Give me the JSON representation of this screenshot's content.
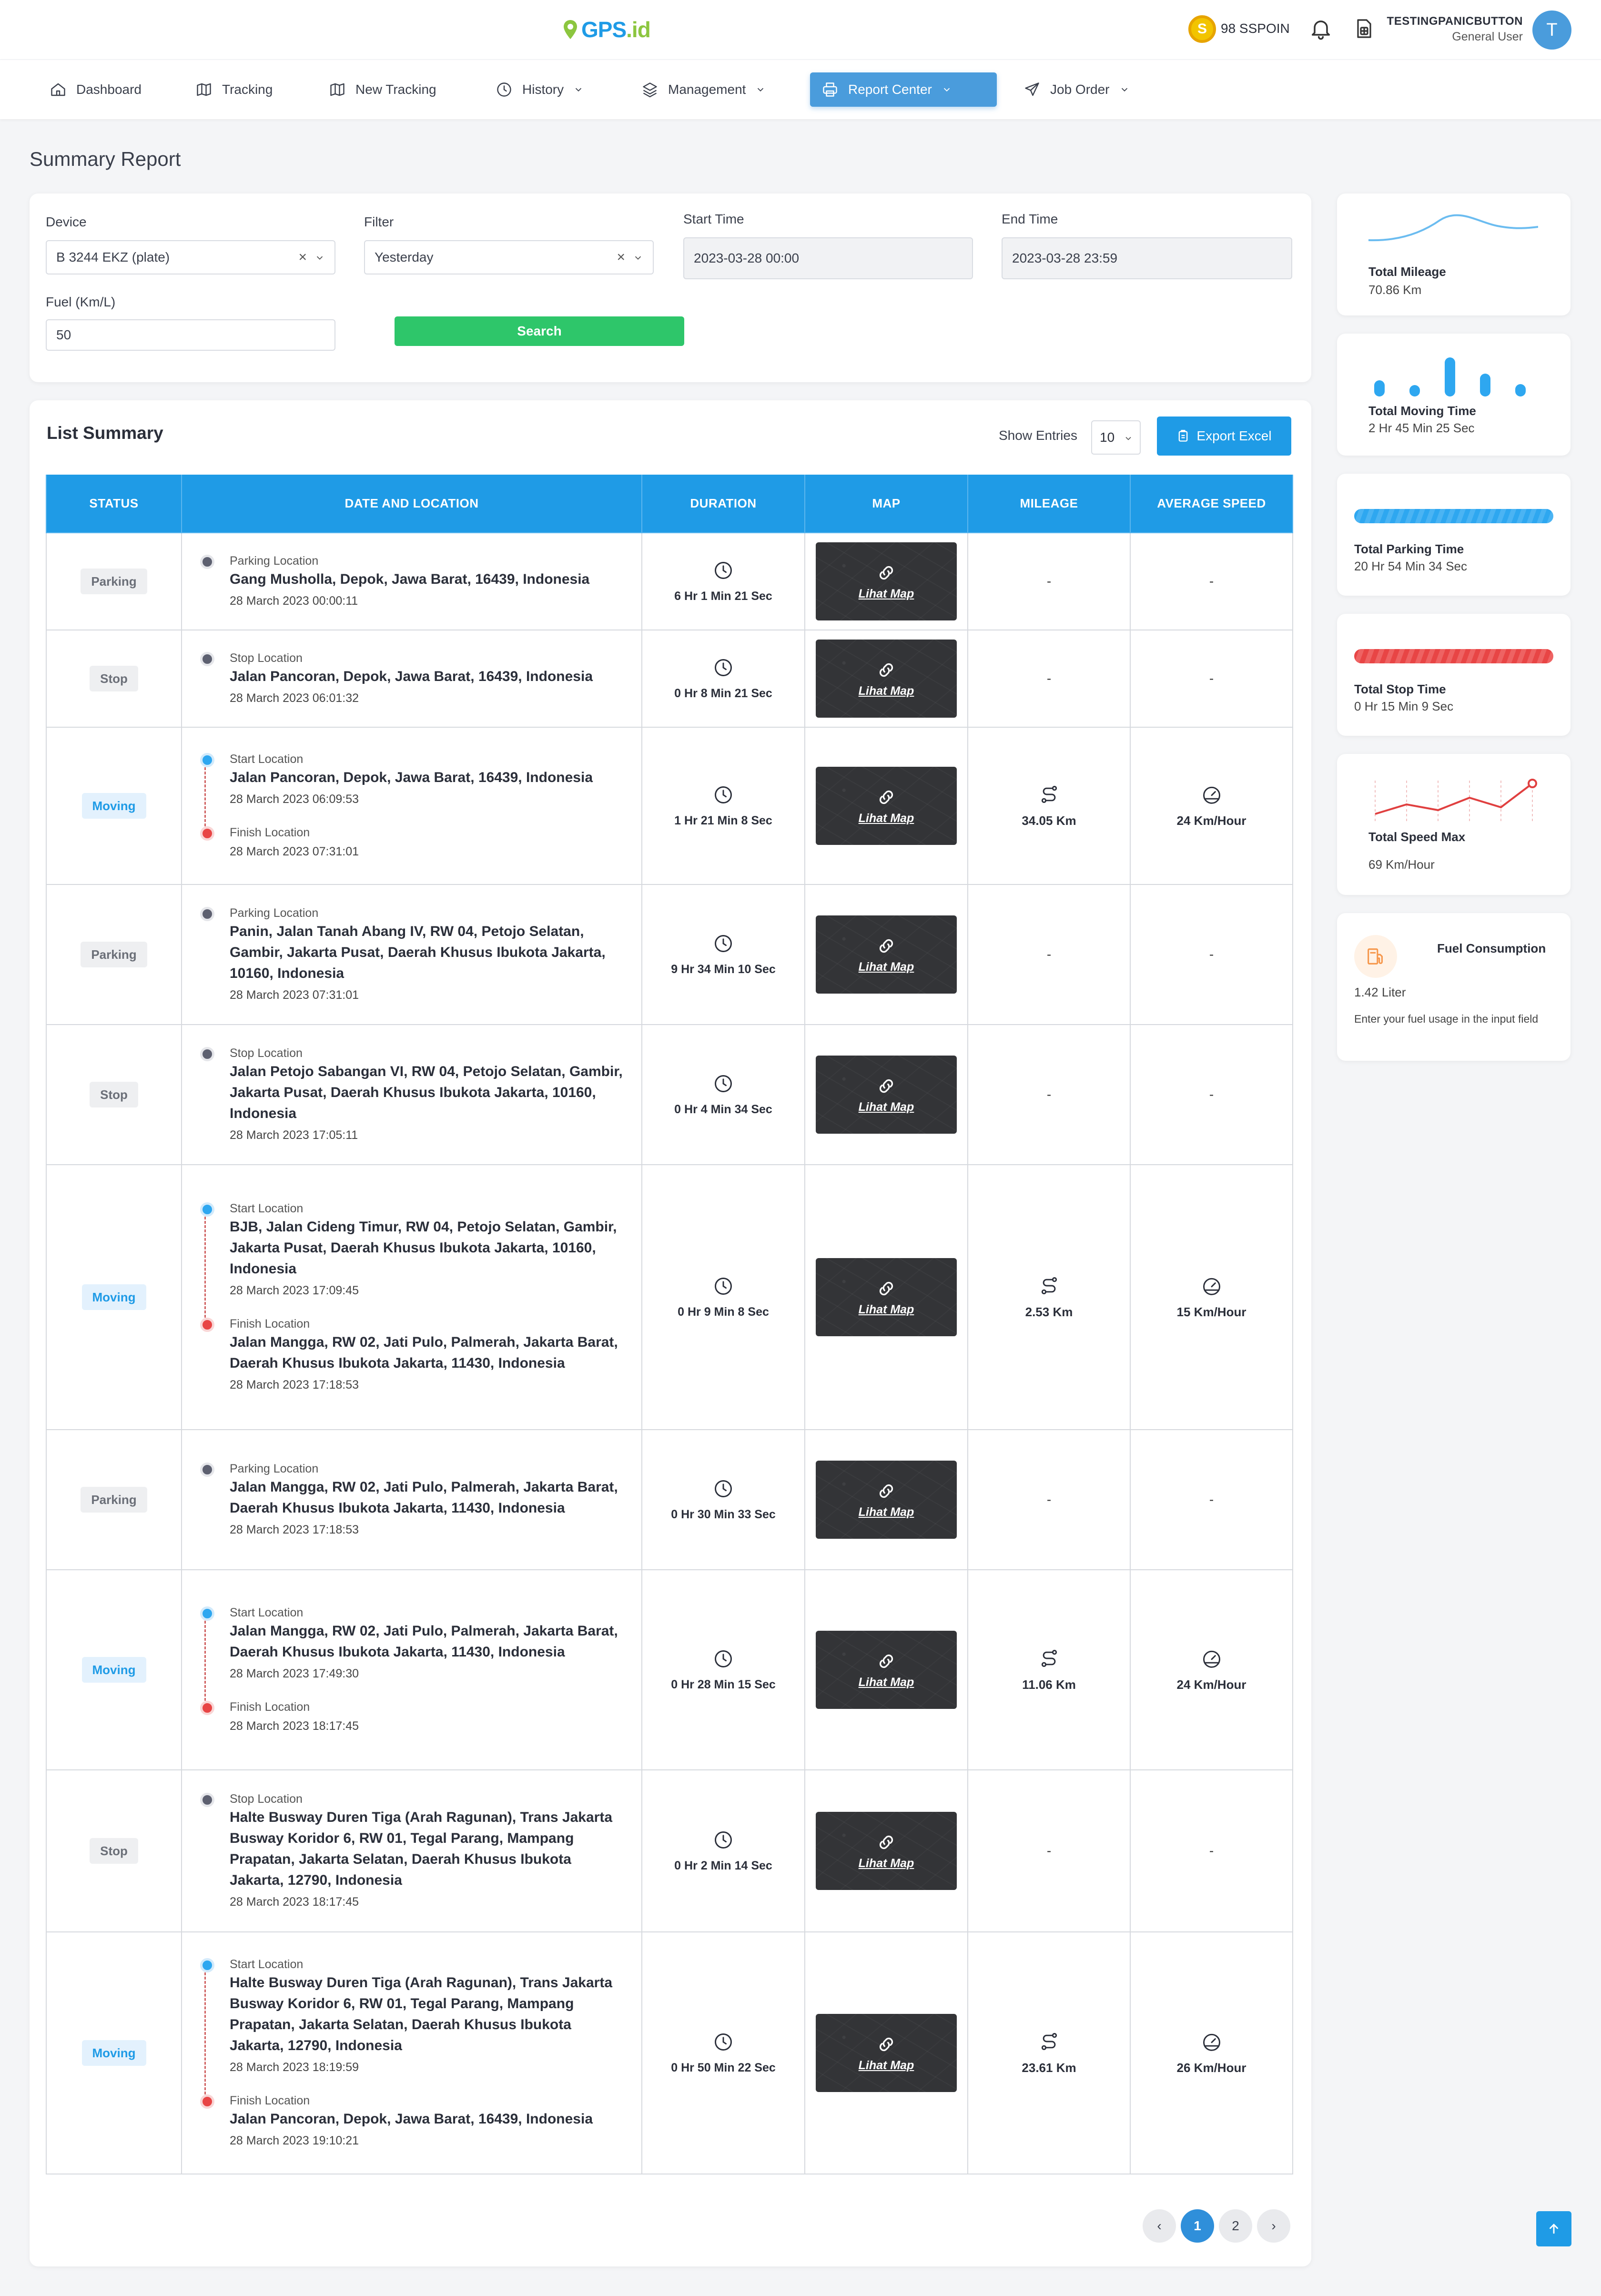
{
  "brand": {
    "logo_text_a": "GPS",
    "logo_text_b": ".id"
  },
  "header": {
    "points_label": "98 SSPOIN",
    "coin_symbol": "S",
    "user_name": "TESTINGPANICBUTTON",
    "user_role": "General User",
    "avatar_initial": "T"
  },
  "nav": {
    "dashboard": "Dashboard",
    "tracking": "Tracking",
    "new_tracking": "New Tracking",
    "history": "History",
    "management": "Management",
    "report_center": "Report Center",
    "job_order": "Job Order"
  },
  "page": {
    "title": "Summary Report"
  },
  "filters": {
    "device_label": "Device",
    "device_value": "B 3244 EKZ (plate)",
    "filter_label": "Filter",
    "filter_value": "Yesterday",
    "start_label": "Start Time",
    "start_value": "2023-03-28 00:00",
    "end_label": "End Time",
    "end_value": "2023-03-28 23:59",
    "fuel_label": "Fuel (Km/L)",
    "fuel_value": "50",
    "search_label": "Search",
    "clear_symbol": "×"
  },
  "list": {
    "title": "List Summary",
    "show_entries_label": "Show Entries",
    "entries_value": "10",
    "export_label": "Export Excel",
    "columns": [
      "STATUS",
      "DATE AND LOCATION",
      "DURATION",
      "MAP",
      "MILEAGE",
      "AVERAGE SPEED"
    ],
    "map_link": "Lihat Map",
    "dash": "-",
    "rows": [
      {
        "status": "Parking",
        "kind": "single",
        "label": "Parking Location",
        "address": "Gang Musholla, Depok, Jawa Barat, 16439, Indonesia",
        "time": "28 March 2023 00:00:11",
        "duration": "6 Hr 1 Min 21 Sec"
      },
      {
        "status": "Stop",
        "kind": "single",
        "label": "Stop Location",
        "address": "Jalan Pancoran, Depok, Jawa Barat, 16439, Indonesia",
        "time": "28 March 2023 06:01:32",
        "duration": "0 Hr 8 Min 21 Sec"
      },
      {
        "status": "Moving",
        "kind": "move",
        "start_label": "Start Location",
        "start_address": "Jalan Pancoran, Depok, Jawa Barat, 16439, Indonesia",
        "start_time": "28 March 2023 06:09:53",
        "finish_label": "Finish Location",
        "finish_address": "",
        "finish_time": "28 March 2023 07:31:01",
        "duration": "1 Hr 21 Min 8 Sec",
        "mileage": "34.05 Km",
        "speed": "24 Km/Hour"
      },
      {
        "status": "Parking",
        "kind": "single",
        "label": "Parking Location",
        "address": "Panin, Jalan Tanah Abang IV, RW 04, Petojo Selatan, Gambir, Jakarta Pusat, Daerah Khusus Ibukota Jakarta, 10160, Indonesia",
        "time": "28 March 2023 07:31:01",
        "duration": "9 Hr 34 Min 10 Sec"
      },
      {
        "status": "Stop",
        "kind": "single",
        "label": "Stop Location",
        "address": "Jalan Petojo Sabangan VI, RW 04, Petojo Selatan, Gambir, Jakarta Pusat, Daerah Khusus Ibukota Jakarta, 10160, Indonesia",
        "time": "28 March 2023 17:05:11",
        "duration": "0 Hr 4 Min 34 Sec"
      },
      {
        "status": "Moving",
        "kind": "move",
        "start_label": "Start Location",
        "start_address": "BJB, Jalan Cideng Timur, RW 04, Petojo Selatan, Gambir, Jakarta Pusat, Daerah Khusus Ibukota Jakarta, 10160, Indonesia",
        "start_time": "28 March 2023 17:09:45",
        "finish_label": "Finish Location",
        "finish_address": "Jalan Mangga, RW 02, Jati Pulo, Palmerah, Jakarta Barat, Daerah Khusus Ibukota Jakarta, 11430, Indonesia",
        "finish_time": "28 March 2023 17:18:53",
        "duration": "0 Hr 9 Min 8 Sec",
        "mileage": "2.53 Km",
        "speed": "15 Km/Hour"
      },
      {
        "status": "Parking",
        "kind": "single",
        "label": "Parking Location",
        "address": "Jalan Mangga, RW 02, Jati Pulo, Palmerah, Jakarta Barat, Daerah Khusus Ibukota Jakarta, 11430, Indonesia",
        "time": "28 March 2023 17:18:53",
        "duration": "0 Hr 30 Min 33 Sec"
      },
      {
        "status": "Moving",
        "kind": "move",
        "start_label": "Start Location",
        "start_address": "Jalan Mangga, RW 02, Jati Pulo, Palmerah, Jakarta Barat, Daerah Khusus Ibukota Jakarta, 11430, Indonesia",
        "start_time": "28 March 2023 17:49:30",
        "finish_label": "Finish Location",
        "finish_address": "",
        "finish_time": "28 March 2023 18:17:45",
        "duration": "0 Hr 28 Min 15 Sec",
        "mileage": "11.06 Km",
        "speed": "24 Km/Hour"
      },
      {
        "status": "Stop",
        "kind": "single",
        "label": "Stop Location",
        "address": "Halte Busway Duren Tiga (Arah Ragunan), Trans Jakarta Busway Koridor 6, RW 01, Tegal Parang, Mampang Prapatan, Jakarta Selatan, Daerah Khusus Ibukota Jakarta, 12790, Indonesia",
        "time": "28 March 2023 18:17:45",
        "duration": "0 Hr 2 Min 14 Sec"
      },
      {
        "status": "Moving",
        "kind": "move",
        "start_label": "Start Location",
        "start_address": "Halte Busway Duren Tiga (Arah Ragunan), Trans Jakarta Busway Koridor 6, RW 01, Tegal Parang, Mampang Prapatan, Jakarta Selatan, Daerah Khusus Ibukota Jakarta, 12790, Indonesia",
        "start_time": "28 March 2023 18:19:59",
        "finish_label": "Finish Location",
        "finish_address": "Jalan Pancoran, Depok, Jawa Barat, 16439, Indonesia",
        "finish_time": "28 March 2023 19:10:21",
        "duration": "0 Hr 50 Min 22 Sec",
        "mileage": "23.61 Km",
        "speed": "26 Km/Hour"
      }
    ]
  },
  "pagination": {
    "prev": "‹",
    "next": "›",
    "pages": [
      "1",
      "2"
    ],
    "current": "1"
  },
  "stats": {
    "mileage_title": "Total Mileage",
    "mileage_value": "70.86 Km",
    "moving_title": "Total Moving Time",
    "moving_value": "2 Hr 45 Min 25 Sec",
    "parking_title": "Total Parking Time",
    "parking_value": "20 Hr 54 Min 34 Sec",
    "stop_title": "Total Stop Time",
    "stop_value": "0 Hr 15 Min 9 Sec",
    "speed_title": "Total Speed Max",
    "speed_value": "69 Km/Hour",
    "fuel_title": "Fuel Consumption",
    "fuel_value": "1.42 Liter",
    "fuel_hint": "Enter your fuel usage in the input field"
  },
  "colors": {
    "primary": "#1f9be6",
    "success": "#2ec66a",
    "danger": "#e84545",
    "accent_yellow": "#f2c400"
  },
  "icons": [
    "map-pin-icon",
    "coin-icon",
    "bell-icon",
    "sim-card-icon",
    "home-icon",
    "map-icon",
    "clock-icon",
    "layers-icon",
    "printer-icon",
    "send-icon",
    "chevron-down-icon",
    "clipboard-icon",
    "link-icon",
    "route-icon",
    "speedometer-icon",
    "fuel-icon",
    "arrow-up-icon"
  ]
}
